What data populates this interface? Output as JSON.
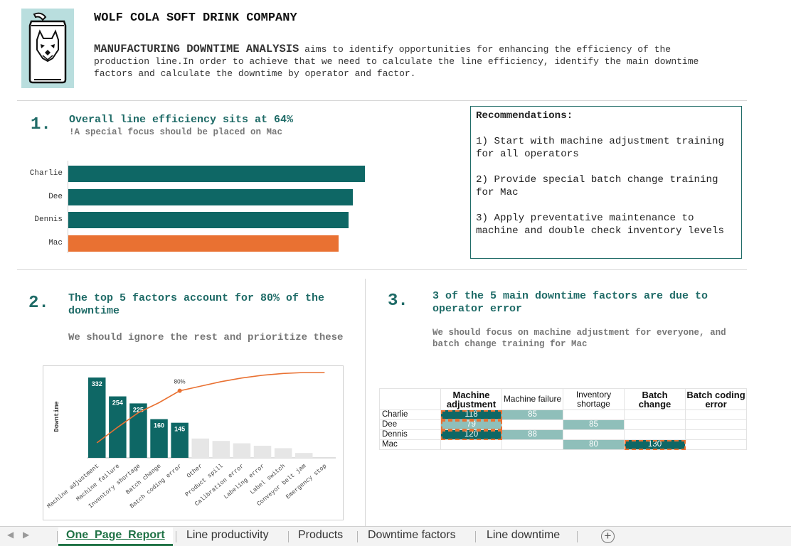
{
  "header": {
    "company": "WOLF COLA SOFT DRINK COMPANY",
    "intro_title": "MANUFACTURING DOWNTIME ANALYSIS",
    "intro_text": " aims to identify opportunities for enhancing the efficiency of the production line.In order to achieve that we need to calculate the line efficiency, identify the main downtime factors and calculate the downtime by operator and factor."
  },
  "section1": {
    "number": "1.",
    "heading": "Overall line efficiency sits at 64%",
    "subheading": "!A special focus should be placed on Mac"
  },
  "recommendations": {
    "title": "Recommendations:",
    "items": [
      "1) Start with machine adjustment training for all operators",
      "2) Provide special batch change training for Mac",
      "3) Apply preventative maintenance to machine and double check inventory levels"
    ]
  },
  "section2": {
    "number": "2.",
    "heading": "The top 5 factors account for 80% of the downtime",
    "subheading": "We should ignore the rest and prioritize these"
  },
  "section3": {
    "number": "3.",
    "heading": "3 of the 5 main downtime factors are due to operator error",
    "subheading": "We should focus on machine adjustment for everyone, and batch change training for Mac"
  },
  "chart_data": [
    {
      "type": "bar",
      "orientation": "horizontal",
      "categories": [
        "Charlie",
        "Dee",
        "Dennis",
        "Mac"
      ],
      "values": [
        0.695,
        0.667,
        0.657,
        0.633
      ],
      "colors": [
        "#0e6765",
        "#0e6765",
        "#0e6765",
        "#e97132"
      ],
      "xlim": [
        0,
        1
      ]
    },
    {
      "type": "bar",
      "categories": [
        "Machine adjustment",
        "Machine failure",
        "Inventory shortage",
        "Batch change",
        "Batch coding error",
        "Other",
        "Product spill",
        "Calibration error",
        "Labeling error",
        "Label switch",
        "Conveyor belt jam",
        "Emergency stop"
      ],
      "values": [
        332,
        254,
        225,
        160,
        145,
        80,
        70,
        60,
        50,
        40,
        20,
        0
      ],
      "labeled_count": 5,
      "cumulative_pct": [
        0.23,
        0.4,
        0.56,
        0.67,
        0.8,
        0.85,
        0.9,
        0.94,
        0.97,
        0.99,
        1.0,
        1.0
      ],
      "cumulative_label": "80%",
      "ylabel": "Downtime",
      "highlight_color": "#0e6765",
      "muted_color": "#e6e6e6",
      "line_color": "#e97132"
    },
    {
      "type": "table",
      "columns": [
        "Machine adjustment",
        "Machine failure",
        "Inventory shortage",
        "Batch change",
        "Batch coding error"
      ],
      "rows": [
        {
          "name": "Charlie",
          "values": [
            "118",
            "85",
            "",
            "",
            ""
          ]
        },
        {
          "name": "Dee",
          "values": [
            "79",
            "",
            "85",
            "",
            ""
          ]
        },
        {
          "name": "Dennis",
          "values": [
            "120",
            "88",
            "",
            "",
            ""
          ]
        },
        {
          "name": "Mac",
          "values": [
            "",
            "",
            "80",
            "130",
            ""
          ]
        }
      ]
    }
  ],
  "tabs": {
    "active": "One_Page_Report",
    "others": [
      "Line productivity",
      "Products",
      "Downtime factors",
      "Line downtime"
    ]
  }
}
